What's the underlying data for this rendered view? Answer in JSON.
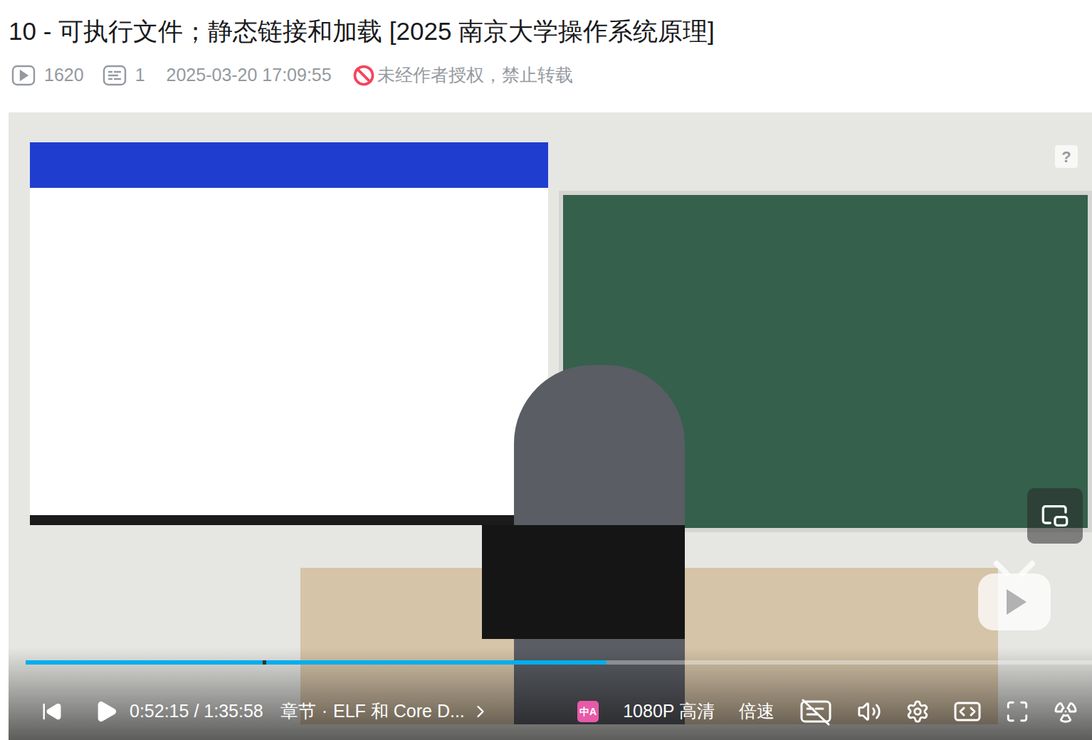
{
  "video": {
    "title": "10 - 可执行文件；静态链接和加载 [2025 南京大学操作系统原理]",
    "views": "1620",
    "danmaku": "1",
    "pubdate": "2025-03-20 17:09:55",
    "copyright": "未经作者授权，禁止转载"
  },
  "player": {
    "playing": false,
    "progress": {
      "level": 0.545,
      "chapter_marks": [
        0.222
      ]
    },
    "time_current": "0:52:15",
    "time_sep": "/",
    "time_total": "1:35:58",
    "chapter_label": "章节",
    "chapter_dot": "·",
    "chapter_title": "ELF 和 Core D...",
    "translate_badge": "中A",
    "quality": "1080P 高清",
    "speed": "倍速",
    "help": "?",
    "subtitles_on": false
  }
}
